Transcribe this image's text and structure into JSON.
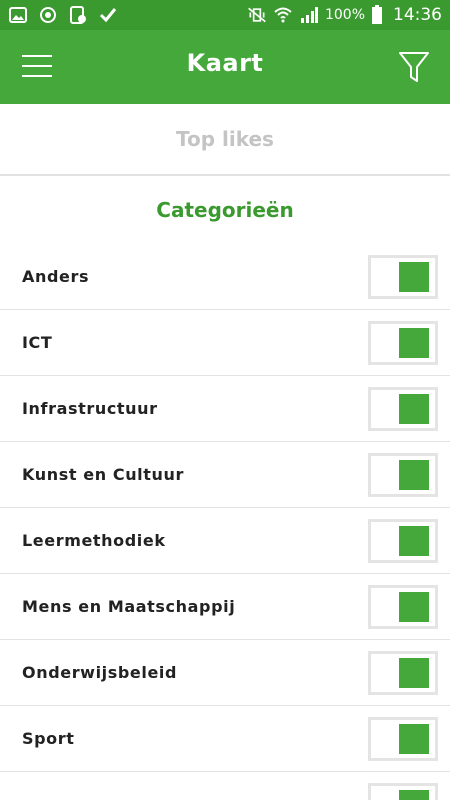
{
  "status_bar": {
    "battery_percent": "100%",
    "time": "14:36",
    "icons_left": [
      "gallery-icon",
      "sync-icon",
      "screenshot-icon",
      "check-icon"
    ],
    "icons_right": [
      "mute-vibrate-icon",
      "wifi-icon",
      "signal-icon",
      "battery-icon"
    ]
  },
  "app_bar": {
    "title": "Kaart",
    "menu_icon": "hamburger-menu-icon",
    "filter_icon": "filter-funnel-icon",
    "color": "#45a83a"
  },
  "top_likes": {
    "label": "Top likes"
  },
  "categories": {
    "heading": "Categorieën",
    "items": [
      {
        "label": "Anders",
        "checked": true
      },
      {
        "label": "ICT",
        "checked": true
      },
      {
        "label": "Infrastructuur",
        "checked": true
      },
      {
        "label": "Kunst en Cultuur",
        "checked": true
      },
      {
        "label": "Leermethodiek",
        "checked": true
      },
      {
        "label": "Mens en Maatschappij",
        "checked": true
      },
      {
        "label": "Onderwijsbeleid",
        "checked": true
      },
      {
        "label": "Sport",
        "checked": true
      },
      {
        "label": "",
        "checked": true
      }
    ]
  },
  "colors": {
    "accent": "#45a83a",
    "status_bar": "#3a9a2f",
    "muted_text": "#c4c4c4"
  }
}
